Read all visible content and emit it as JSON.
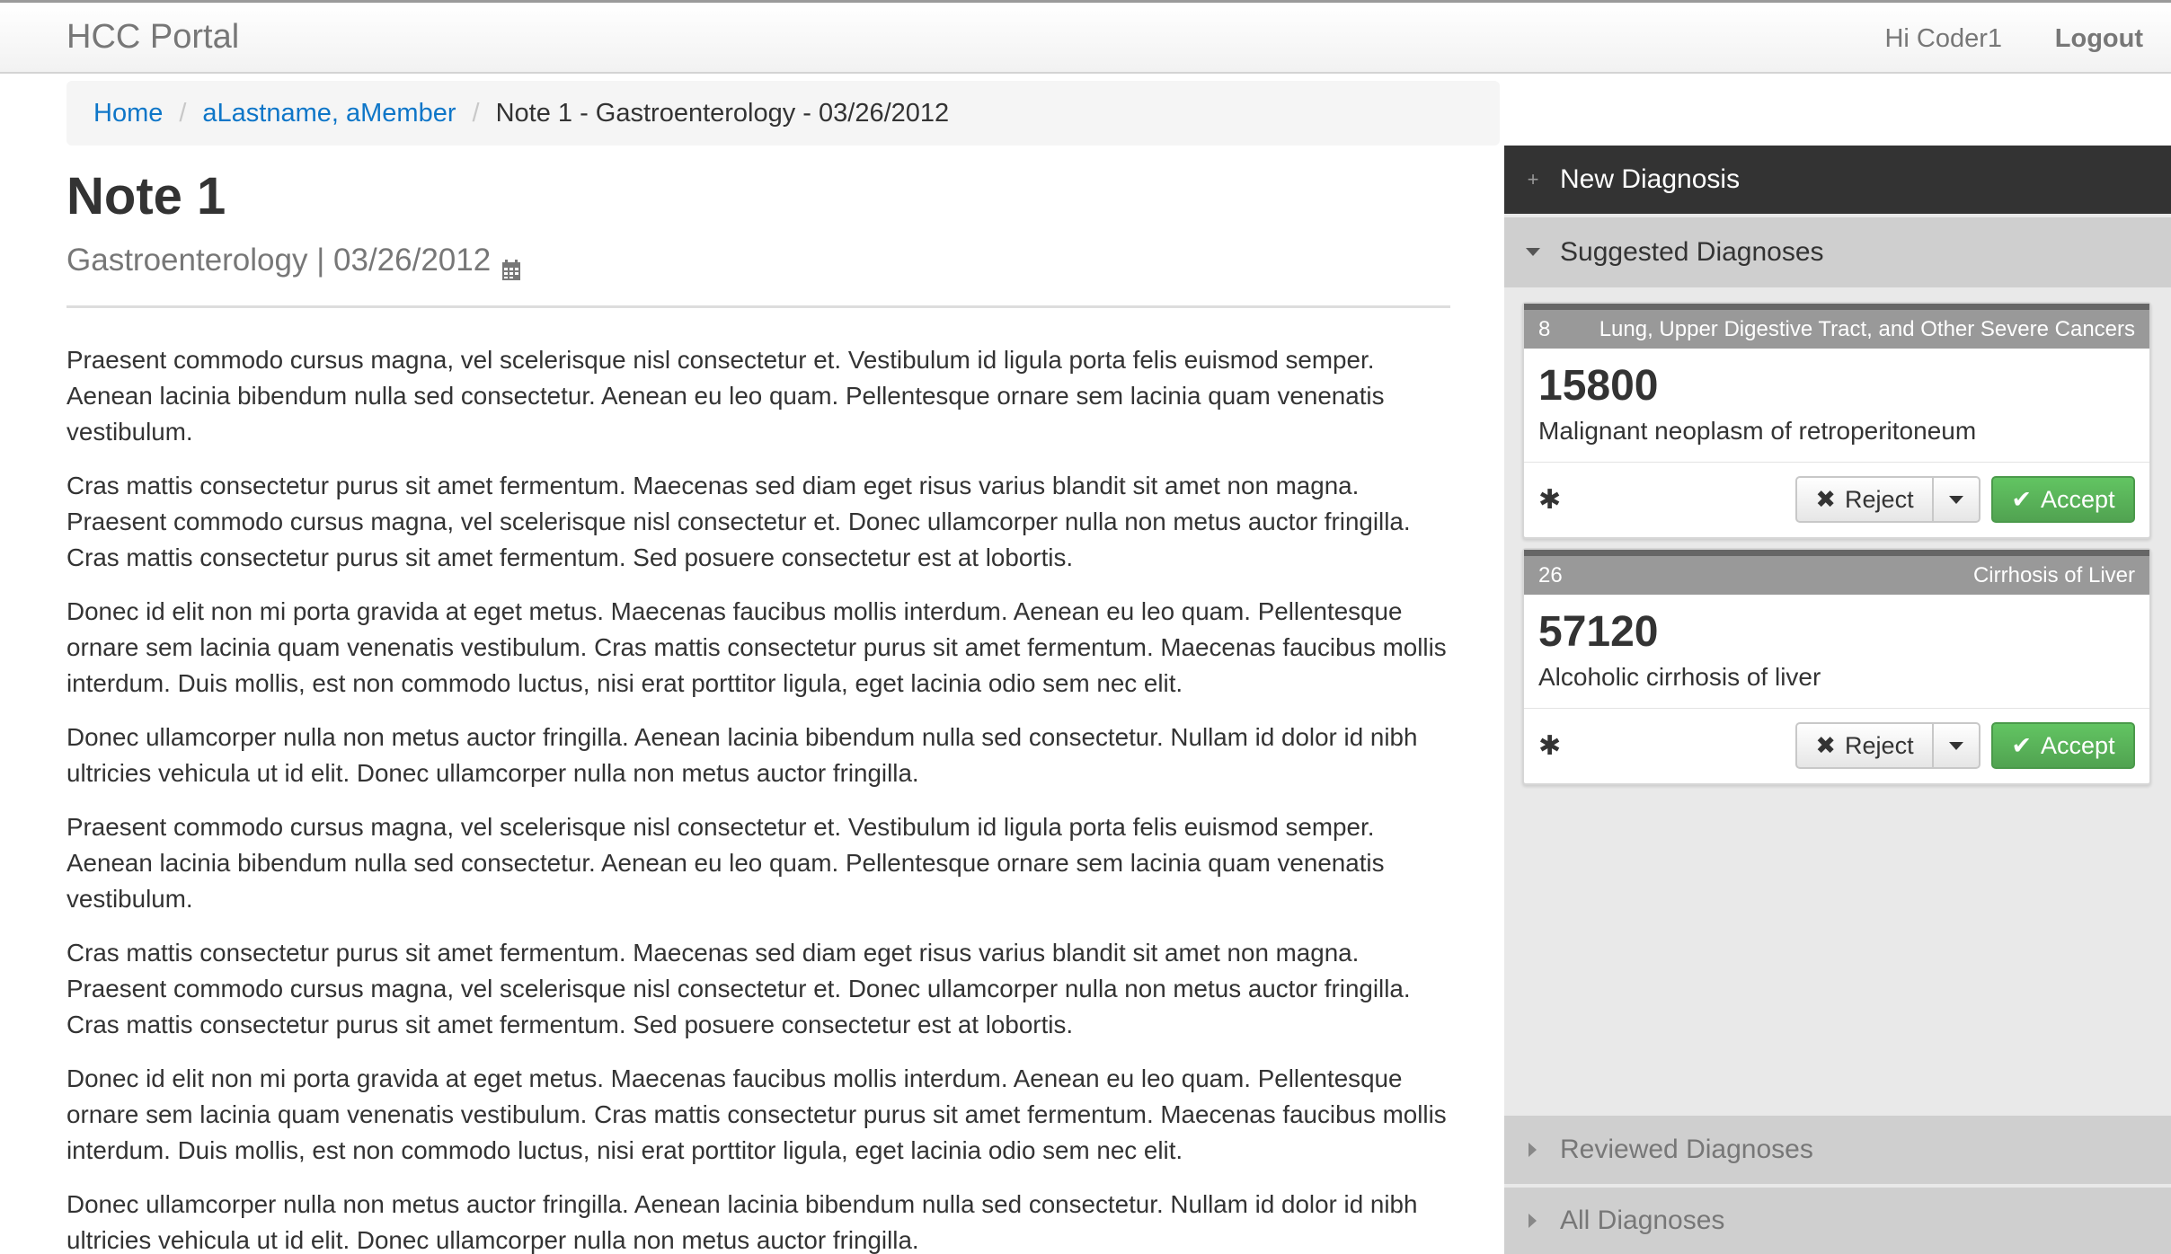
{
  "navbar": {
    "brand": "HCC Portal",
    "greeting": "Hi Coder1",
    "logout": "Logout"
  },
  "breadcrumb": {
    "home": "Home",
    "member": "aLastname, aMember",
    "current": "Note 1 - Gastroenterology - 03/26/2012"
  },
  "note": {
    "title": "Note 1",
    "subtitle": "Gastroenterology | 03/26/2012",
    "paragraphs": [
      "Praesent commodo cursus magna, vel scelerisque nisl consectetur et. Vestibulum id ligula porta felis euismod semper. Aenean lacinia bibendum nulla sed consectetur. Aenean eu leo quam. Pellentesque ornare sem lacinia quam venenatis vestibulum.",
      "Cras mattis consectetur purus sit amet fermentum. Maecenas sed diam eget risus varius blandit sit amet non magna. Praesent commodo cursus magna, vel scelerisque nisl consectetur et. Donec ullamcorper nulla non metus auctor fringilla. Cras mattis consectetur purus sit amet fermentum. Sed posuere consectetur est at lobortis.",
      "Donec id elit non mi porta gravida at eget metus. Maecenas faucibus mollis interdum. Aenean eu leo quam. Pellentesque ornare sem lacinia quam venenatis vestibulum. Cras mattis consectetur purus sit amet fermentum. Maecenas faucibus mollis interdum. Duis mollis, est non commodo luctus, nisi erat porttitor ligula, eget lacinia odio sem nec elit.",
      "Donec ullamcorper nulla non metus auctor fringilla. Aenean lacinia bibendum nulla sed consectetur. Nullam id dolor id nibh ultricies vehicula ut id elit. Donec ullamcorper nulla non metus auctor fringilla.",
      "Praesent commodo cursus magna, vel scelerisque nisl consectetur et. Vestibulum id ligula porta felis euismod semper. Aenean lacinia bibendum nulla sed consectetur. Aenean eu leo quam. Pellentesque ornare sem lacinia quam venenatis vestibulum.",
      "Cras mattis consectetur purus sit amet fermentum. Maecenas sed diam eget risus varius blandit sit amet non magna. Praesent commodo cursus magna, vel scelerisque nisl consectetur et. Donec ullamcorper nulla non metus auctor fringilla. Cras mattis consectetur purus sit amet fermentum. Sed posuere consectetur est at lobortis.",
      "Donec id elit non mi porta gravida at eget metus. Maecenas faucibus mollis interdum. Aenean eu leo quam. Pellentesque ornare sem lacinia quam venenatis vestibulum. Cras mattis consectetur purus sit amet fermentum. Maecenas faucibus mollis interdum. Duis mollis, est non commodo luctus, nisi erat porttitor ligula, eget lacinia odio sem nec elit.",
      "Donec ullamcorper nulla non metus auctor fringilla. Aenean lacinia bibendum nulla sed consectetur. Nullam id dolor id nibh ultricies vehicula ut id elit. Donec ullamcorper nulla non metus auctor fringilla."
    ]
  },
  "panel": {
    "new_diagnosis": "New Diagnosis",
    "suggested": "Suggested Diagnoses",
    "reviewed": "Reviewed Diagnoses",
    "all": "All Diagnoses",
    "cards": [
      {
        "hcc": "8",
        "category": "Lung, Upper Digestive Tract, and Other Severe Cancers",
        "code": "15800",
        "description": "Malignant neoplasm of retroperitoneum",
        "reject_label": "Reject",
        "accept_label": "Accept"
      },
      {
        "hcc": "26",
        "category": "Cirrhosis of Liver",
        "code": "57120",
        "description": "Alcoholic cirrhosis of liver",
        "reject_label": "Reject",
        "accept_label": "Accept"
      }
    ]
  },
  "colors": {
    "link": "#0e76c8",
    "accept": "#5bb75b",
    "panel_dark": "#333333"
  },
  "icons": {
    "new_diagnosis": "plus-icon",
    "suggested": "caret-down-icon",
    "reviewed": "caret-right-icon",
    "all": "caret-right-icon",
    "calendar": "calendar-icon",
    "reject": "x-icon",
    "accept": "checkmark-icon",
    "flag": "asterisk-icon"
  }
}
